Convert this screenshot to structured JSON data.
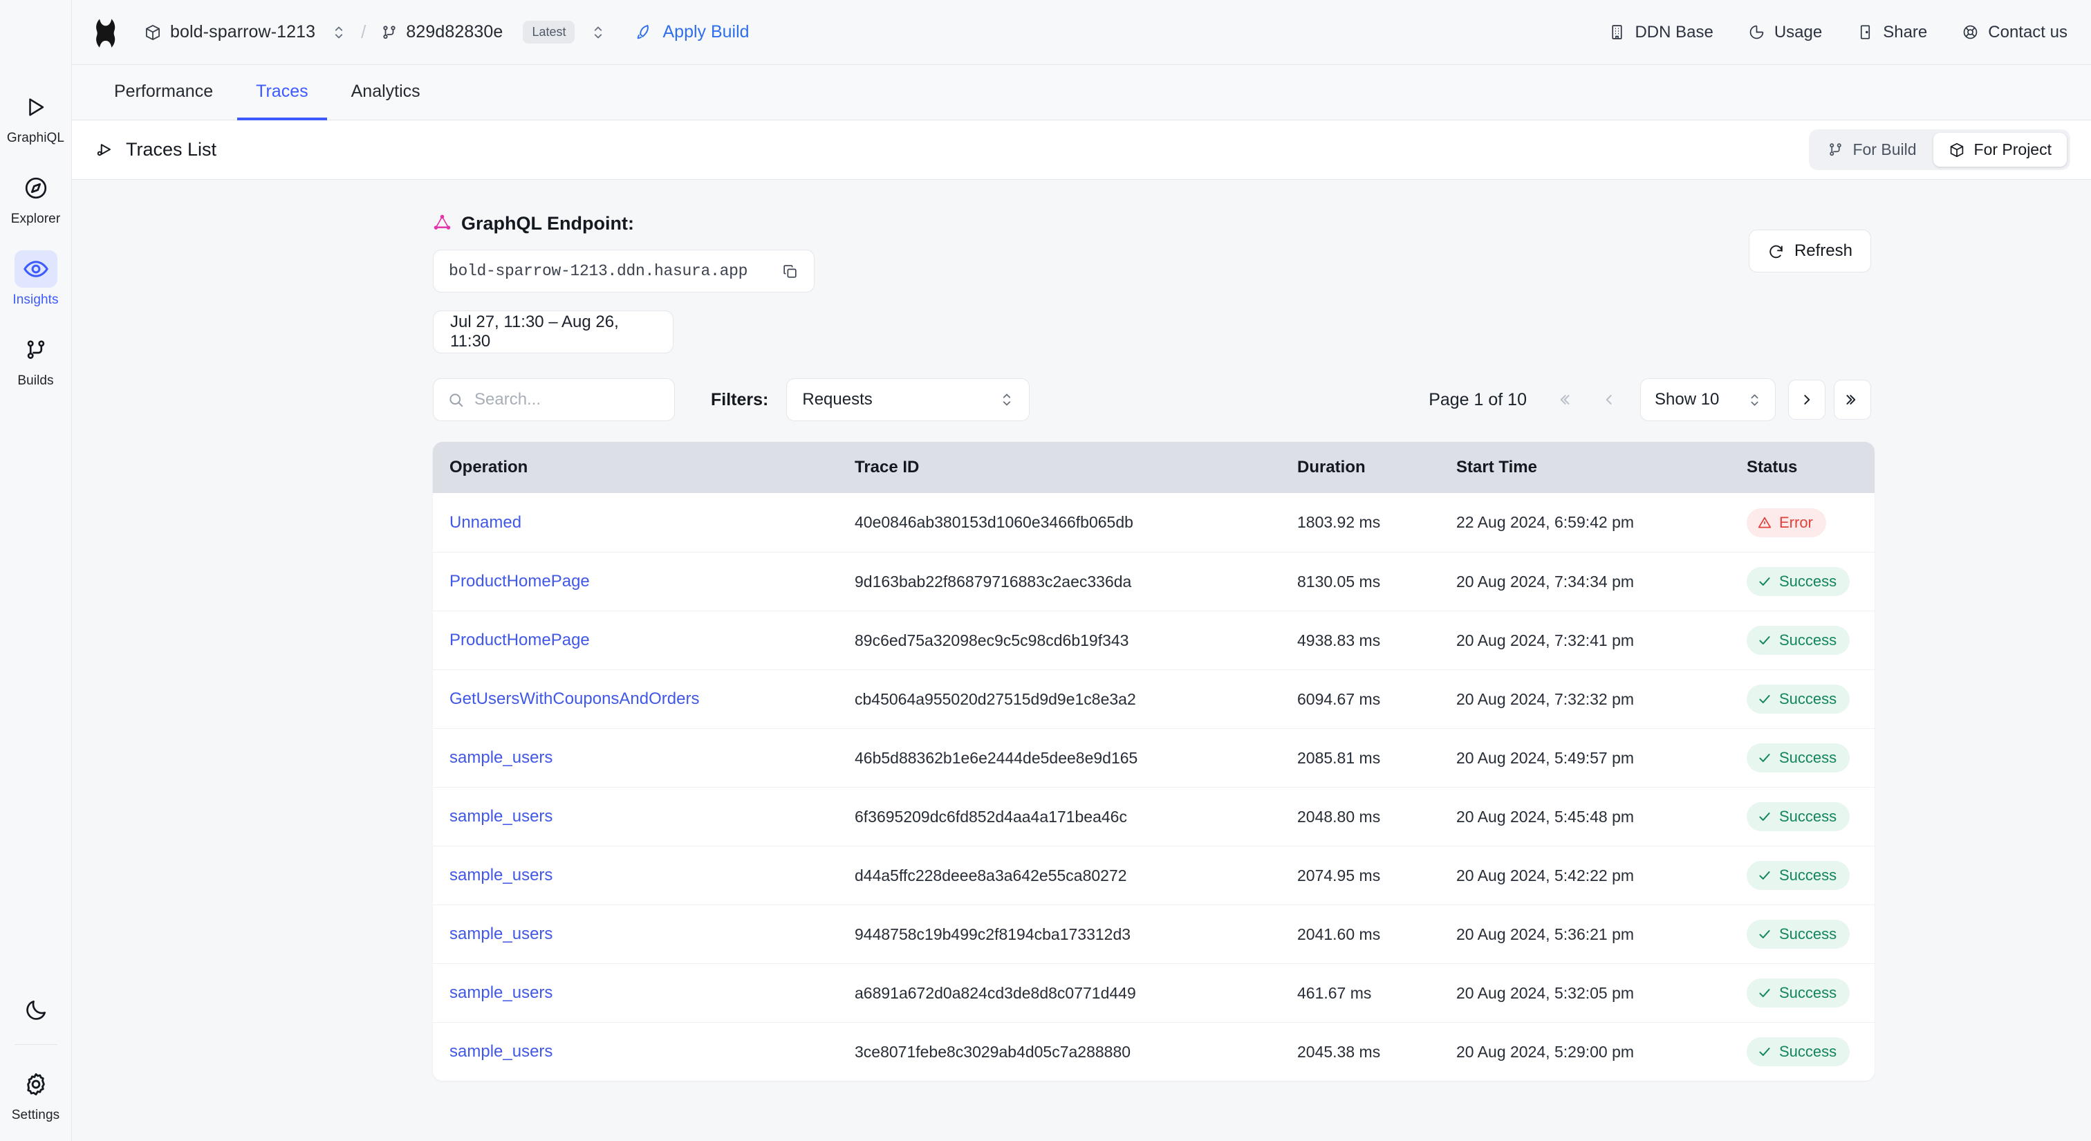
{
  "topbar": {
    "project_name": "bold-sparrow-1213",
    "separator": "/",
    "build_id": "829d82830e",
    "latest_badge": "Latest",
    "apply_build": "Apply Build",
    "links": [
      {
        "label": "DDN Base",
        "icon": "building-icon"
      },
      {
        "label": "Usage",
        "icon": "pie-chart-icon"
      },
      {
        "label": "Share",
        "icon": "door-icon"
      },
      {
        "label": "Contact us",
        "icon": "lifebuoy-icon"
      }
    ]
  },
  "sidebar": {
    "items": [
      {
        "label": "GraphiQL",
        "icon": "play-triangle-icon",
        "active": false
      },
      {
        "label": "Explorer",
        "icon": "compass-icon",
        "active": false
      },
      {
        "label": "Insights",
        "icon": "eye-icon",
        "active": true
      },
      {
        "label": "Builds",
        "icon": "branch-icon",
        "active": false
      }
    ],
    "bottom": [
      {
        "label": "",
        "icon": "moon-icon"
      },
      {
        "label": "Settings",
        "icon": "gear-icon"
      }
    ]
  },
  "tabs": [
    {
      "label": "Performance",
      "active": false
    },
    {
      "label": "Traces",
      "active": true
    },
    {
      "label": "Analytics",
      "active": false
    }
  ],
  "subbar": {
    "title": "Traces List",
    "title_icon": "trace-icon",
    "segments": [
      {
        "label": "For Build",
        "icon": "branch-icon",
        "active": false
      },
      {
        "label": "For Project",
        "icon": "cube-icon",
        "active": true
      }
    ]
  },
  "endpoint": {
    "label": "GraphQL Endpoint:",
    "icon": "graphql-icon",
    "url": "bold-sparrow-1213.ddn.hasura.app",
    "copy_icon": "copy-icon",
    "date_range": "Jul 27, 11:30 – Aug 26, 11:30"
  },
  "refresh": {
    "label": "Refresh",
    "icon": "refresh-icon"
  },
  "toolbar": {
    "search_placeholder": "Search...",
    "search_value": "",
    "search_icon": "search-icon",
    "filters_label": "Filters:",
    "filter_selected": "Requests",
    "page_text": "Page 1 of 10",
    "show_selected": "Show 10",
    "first_icon": "chevrons-left-icon",
    "prev_icon": "chevron-left-icon",
    "next_icon": "chevron-right-icon",
    "last_icon": "chevrons-right-icon"
  },
  "table": {
    "columns": [
      "Operation",
      "Trace ID",
      "Duration",
      "Start Time",
      "Status"
    ],
    "rows": [
      {
        "operation": "Unnamed",
        "trace_id": "40e0846ab380153d1060e3466fb065db",
        "duration": "1803.92 ms",
        "start_time": "22 Aug 2024, 6:59:42 pm",
        "status": "Error"
      },
      {
        "operation": "ProductHomePage",
        "trace_id": "9d163bab22f86879716883c2aec336da",
        "duration": "8130.05 ms",
        "start_time": "20 Aug 2024, 7:34:34 pm",
        "status": "Success"
      },
      {
        "operation": "ProductHomePage",
        "trace_id": "89c6ed75a32098ec9c5c98cd6b19f343",
        "duration": "4938.83 ms",
        "start_time": "20 Aug 2024, 7:32:41 pm",
        "status": "Success"
      },
      {
        "operation": "GetUsersWithCouponsAndOrders",
        "trace_id": "cb45064a955020d27515d9d9e1c8e3a2",
        "duration": "6094.67 ms",
        "start_time": "20 Aug 2024, 7:32:32 pm",
        "status": "Success"
      },
      {
        "operation": "sample_users",
        "trace_id": "46b5d88362b1e6e2444de5dee8e9d165",
        "duration": "2085.81 ms",
        "start_time": "20 Aug 2024, 5:49:57 pm",
        "status": "Success"
      },
      {
        "operation": "sample_users",
        "trace_id": "6f3695209dc6fd852d4aa4a171bea46c",
        "duration": "2048.80 ms",
        "start_time": "20 Aug 2024, 5:45:48 pm",
        "status": "Success"
      },
      {
        "operation": "sample_users",
        "trace_id": "d44a5ffc228deee8a3a642e55ca80272",
        "duration": "2074.95 ms",
        "start_time": "20 Aug 2024, 5:42:22 pm",
        "status": "Success"
      },
      {
        "operation": "sample_users",
        "trace_id": "9448758c19b499c2f8194cba173312d3",
        "duration": "2041.60 ms",
        "start_time": "20 Aug 2024, 5:36:21 pm",
        "status": "Success"
      },
      {
        "operation": "sample_users",
        "trace_id": "a6891a672d0a824cd3de8d8c0771d449",
        "duration": "461.67 ms",
        "start_time": "20 Aug 2024, 5:32:05 pm",
        "status": "Success"
      },
      {
        "operation": "sample_users",
        "trace_id": "3ce8071febe8c3029ab4d05c7a288880",
        "duration": "2045.38 ms",
        "start_time": "20 Aug 2024, 5:29:00 pm",
        "status": "Success"
      }
    ]
  },
  "colors": {
    "accent": "#3d5afe",
    "link": "#4158e6",
    "success": "#12865a",
    "error": "#e0423b",
    "graphql_pink": "#e535ab"
  }
}
